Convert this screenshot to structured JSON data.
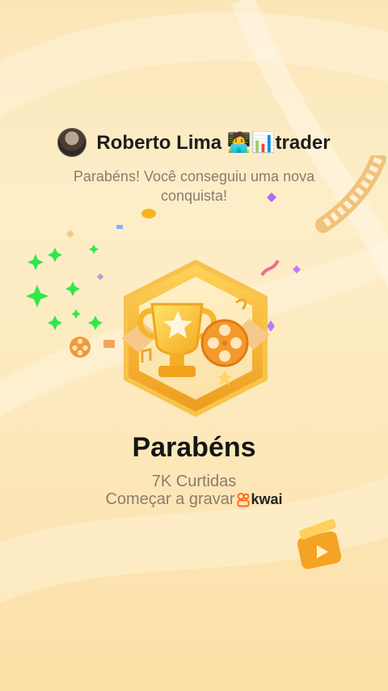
{
  "header": {
    "username": "Roberto Lima 🧑‍💻📊trader",
    "message": "Parabéns! Você conseguiu uma nova conquista!"
  },
  "main": {
    "title": "Parabéns",
    "likes": "7K Curtidas",
    "record_text": "Começar a gravar",
    "brand": "kwai"
  },
  "colors": {
    "background": "#fde9bd",
    "badge_gold": "#f2b632",
    "sparkle_green": "#2ee84a",
    "kwai_orange": "#ff6a1a"
  },
  "icons": [
    "avatar",
    "trophy-badge-icon",
    "film-reel-icon",
    "video-clapper-icon",
    "kwai-logo-icon"
  ]
}
